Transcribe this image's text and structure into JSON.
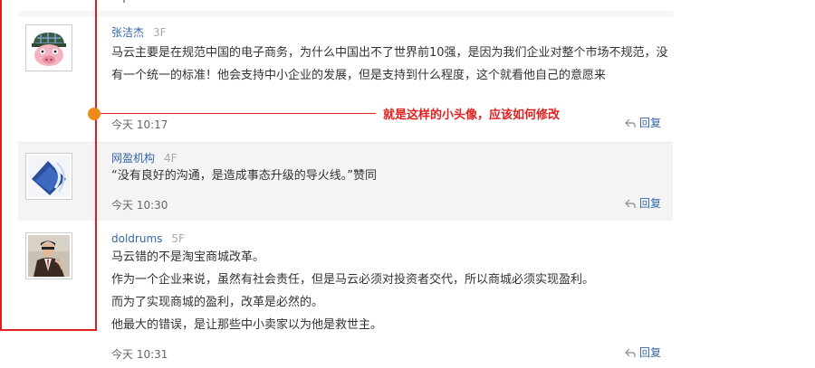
{
  "comments": [
    {
      "username": "张洁杰",
      "floor": "3F",
      "avatar": "pig-cap-avatar",
      "body_lines": [
        "马云主要是在规范中国的电子商务，为什么中国出不了世界前10强，是因为我们企业对整个市场不规范，没有一个统一的标准！他会支持中小企业的发展，但是支持到什么程度，这个就看他自己的意愿来"
      ],
      "time": "今天 10:17",
      "reply_label": "回复"
    },
    {
      "username": "网盈机构",
      "floor": "4F",
      "avatar": "blue-logo-avatar",
      "body_lines": [
        "“没有良好的沟通，是造成事态升级的导火线。”赞同"
      ],
      "time": "今天 10:30",
      "reply_label": "回复"
    },
    {
      "username": "doldrums",
      "floor": "5F",
      "avatar": "person-photo-avatar",
      "body_lines": [
        "马云错的不是淘宝商城改革。",
        "作为一个企业来说，虽然有社会责任，但是马云必须对投资者交代，所以商城必须实现盈利。",
        "而为了实现商城的盈利，改革是必然的。",
        "他最大的错误，是让那些中小卖家以为他是救世主。"
      ],
      "time": "今天 10:31",
      "reply_label": "回复"
    }
  ],
  "annotation": {
    "text": "就是这样的小头像，应该如何修改",
    "color": "#e02020",
    "dot_color": "#f08a1a"
  },
  "colors": {
    "username": "#3366aa",
    "floor": "#aaaaaa",
    "alt_row_bg": "#f4f4f4"
  }
}
